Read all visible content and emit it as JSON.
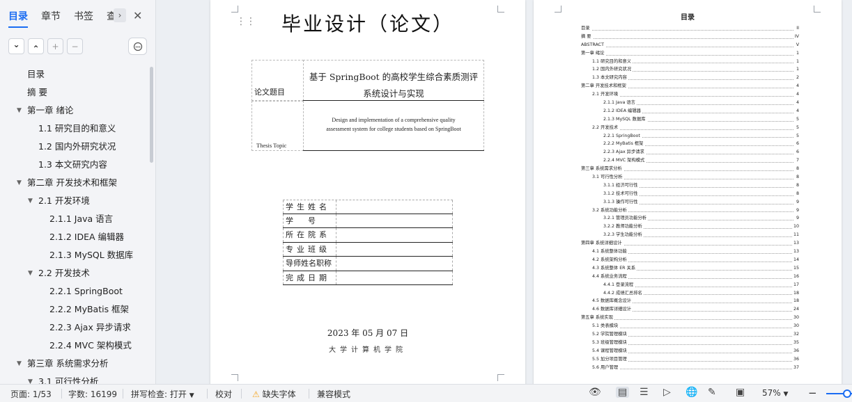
{
  "sidebar": {
    "tabs": [
      {
        "label": "目录"
      },
      {
        "label": "章节"
      },
      {
        "label": "书签"
      },
      {
        "label": "查找"
      }
    ],
    "tools": {
      "collapse": "⌄",
      "expand": "⌃",
      "add": "+",
      "remove": "−"
    },
    "toc": [
      {
        "label": "目录",
        "level": 1
      },
      {
        "label": "摘  要",
        "level": 1
      },
      {
        "label": "第一章 绪论",
        "level": 1
      },
      {
        "label": "1.1 研究目的和意义",
        "level": 2
      },
      {
        "label": "1.2 国内外研究状况",
        "level": 2
      },
      {
        "label": "1.3 本文研究内容",
        "level": 2
      },
      {
        "label": "第二章 开发技术和框架",
        "level": 1
      },
      {
        "label": "2.1 开发环境",
        "level": 2
      },
      {
        "label": "2.1.1 Java 语言",
        "level": 3
      },
      {
        "label": "2.1.2 IDEA 编辑器",
        "level": 3
      },
      {
        "label": "2.1.3 MySQL 数据库",
        "level": 3
      },
      {
        "label": "2.2 开发技术",
        "level": 2
      },
      {
        "label": "2.2.1 SpringBoot",
        "level": 3
      },
      {
        "label": "2.2.2 MyBatis 框架",
        "level": 3
      },
      {
        "label": "2.2.3 Ajax 异步请求",
        "level": 3
      },
      {
        "label": "2.2.4 MVC 架构模式",
        "level": 3
      },
      {
        "label": "第三章 系统需求分析",
        "level": 1
      },
      {
        "label": "3.1 可行性分析",
        "level": 2
      }
    ]
  },
  "cover": {
    "title": "毕业设计（论文）",
    "topic_label": "论文题目",
    "topic_cn_line1": "基于 SpringBoot 的高校学生综合素质测评",
    "topic_cn_line2": "系统设计与实现",
    "topic_en_label": "Thesis Topic",
    "topic_en_line1": "Design and implementation of a comprehensive quality",
    "topic_en_line2": "assessment system for college students based on SpringBoot",
    "fields": [
      {
        "label": "学生姓名",
        "value": ""
      },
      {
        "label": "学      号",
        "value": ""
      },
      {
        "label": "所在院系",
        "value": ""
      },
      {
        "label": "专业班级",
        "value": ""
      },
      {
        "label": "导师姓名职称",
        "value": ""
      },
      {
        "label": "完成日期",
        "value": ""
      }
    ],
    "date": "2023 年 05 月 07 日",
    "school": "大学计算机学院"
  },
  "toc_page": {
    "title": "目录",
    "entries": [
      {
        "text": "目录",
        "page": "II",
        "level": 0
      },
      {
        "text": "摘  要",
        "page": "IV",
        "level": 0
      },
      {
        "text": "ABSTRACT",
        "page": "V",
        "level": 0
      },
      {
        "text": "第一章  绪论",
        "page": "1",
        "level": 0
      },
      {
        "text": "1.1  研究目的和意义",
        "page": "1",
        "level": 1
      },
      {
        "text": "1.2  国内外研究状况",
        "page": "1",
        "level": 1
      },
      {
        "text": "1.3  本文研究内容",
        "page": "2",
        "level": 1
      },
      {
        "text": "第二章  开发技术和框架",
        "page": "4",
        "level": 0
      },
      {
        "text": "2.1  开发环境",
        "page": "4",
        "level": 1
      },
      {
        "text": "2.1.1  Java 语言",
        "page": "4",
        "level": 2
      },
      {
        "text": "2.1.2  IDEA 编辑器",
        "page": "4",
        "level": 2
      },
      {
        "text": "2.1.3  MySQL 数据库",
        "page": "5",
        "level": 2
      },
      {
        "text": "2.2  开发技术",
        "page": "5",
        "level": 1
      },
      {
        "text": "2.2.1  SpringBoot",
        "page": "5",
        "level": 2
      },
      {
        "text": "2.2.2  MyBatis 框架",
        "page": "6",
        "level": 2
      },
      {
        "text": "2.2.3  Ajax 异步请求",
        "page": "6",
        "level": 2
      },
      {
        "text": "2.2.4  MVC 架构模式",
        "page": "7",
        "level": 2
      },
      {
        "text": "第三章  系统需求分析",
        "page": "8",
        "level": 0
      },
      {
        "text": "3.1  可行性分析",
        "page": "8",
        "level": 1
      },
      {
        "text": "3.1.1  经济可行性",
        "page": "8",
        "level": 2
      },
      {
        "text": "3.1.2  技术可行性",
        "page": "8",
        "level": 2
      },
      {
        "text": "3.1.3  操作可行性",
        "page": "9",
        "level": 2
      },
      {
        "text": "3.2  系统功能分析",
        "page": "9",
        "level": 1
      },
      {
        "text": "3.2.1  管理员功能分析",
        "page": "9",
        "level": 2
      },
      {
        "text": "3.2.2  教师功能分析",
        "page": "10",
        "level": 2
      },
      {
        "text": "3.2.3  学生功能分析",
        "page": "11",
        "level": 2
      },
      {
        "text": "第四章  系统详细设计",
        "page": "13",
        "level": 0
      },
      {
        "text": "4.1  系统整体功能",
        "page": "13",
        "level": 1
      },
      {
        "text": "4.2  系统架构分析",
        "page": "14",
        "level": 1
      },
      {
        "text": "4.3  系统整体 ER 关系",
        "page": "15",
        "level": 1
      },
      {
        "text": "4.4  系统业务流程",
        "page": "16",
        "level": 1
      },
      {
        "text": "4.4.1  登录流程",
        "page": "17",
        "level": 2
      },
      {
        "text": "4.4.2  成绩汇总排名",
        "page": "18",
        "level": 2
      },
      {
        "text": "4.5  数据库概念设计",
        "page": "18",
        "level": 1
      },
      {
        "text": "4.6  数据库详细设计",
        "page": "24",
        "level": 1
      },
      {
        "text": "第五章  系统实现",
        "page": "30",
        "level": 0
      },
      {
        "text": "5.1  类表模块",
        "page": "30",
        "level": 1
      },
      {
        "text": "5.2  学院管理模块",
        "page": "32",
        "level": 1
      },
      {
        "text": "5.3  班级管理模块",
        "page": "35",
        "level": 1
      },
      {
        "text": "5.4  课程管理模块",
        "page": "36",
        "level": 1
      },
      {
        "text": "5.5  加分项目管理",
        "page": "36",
        "level": 1
      },
      {
        "text": "5.6  用户管理",
        "page": "37",
        "level": 1
      }
    ]
  },
  "statusbar": {
    "page": "页面: 1/53",
    "words": "字数: 16199",
    "spell": "拼写检查: 打开",
    "proof": "校对",
    "missing_font": "缺失字体",
    "compat": "兼容模式",
    "zoom": "57%",
    "zoom_minus": "−",
    "zoom_plus": "+"
  },
  "colors": {
    "accent": "#1a6cf2",
    "warning": "#f5a623"
  }
}
